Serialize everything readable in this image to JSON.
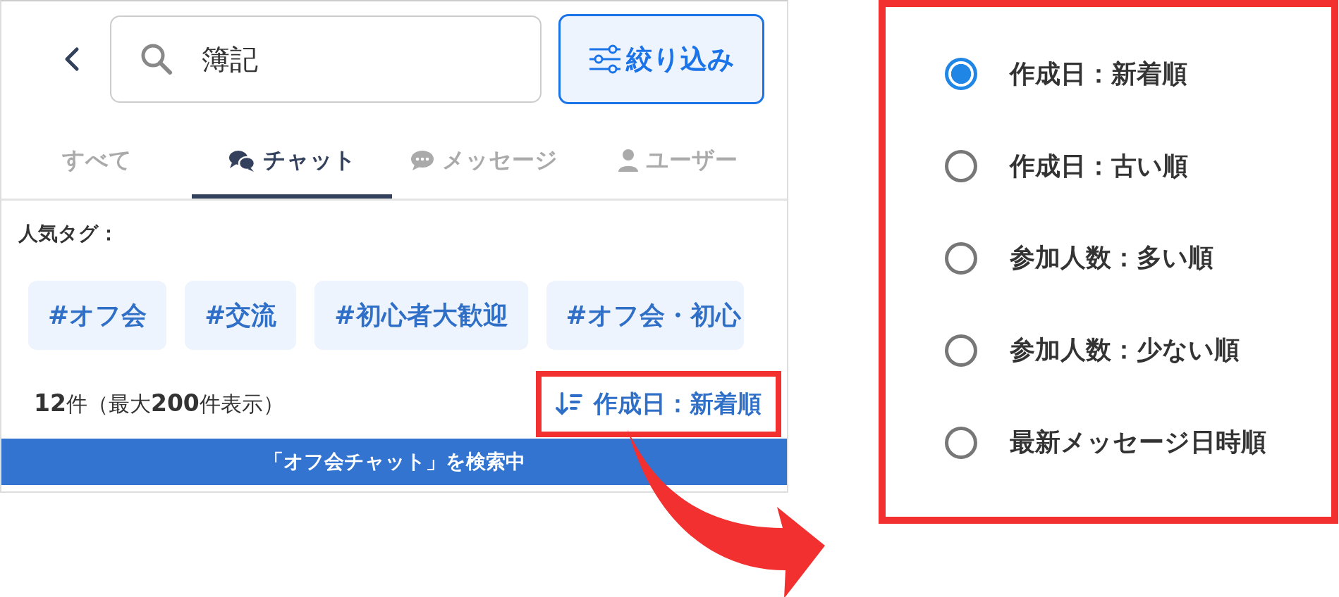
{
  "search": {
    "value": "簿記"
  },
  "filter_button": {
    "label": "絞り込み"
  },
  "tabs": [
    {
      "label": "すべて",
      "kind": "plain",
      "selected": false
    },
    {
      "label": "チャット",
      "kind": "chat",
      "selected": true
    },
    {
      "label": "メッセージ",
      "kind": "message",
      "selected": false
    },
    {
      "label": "ユーザー",
      "kind": "user",
      "selected": false
    }
  ],
  "popular_tags": {
    "label": "人気タグ：",
    "tags": [
      "#オフ会",
      "#交流",
      "#初心者大歓迎",
      "#オフ会・初心"
    ]
  },
  "results": {
    "count": "**12**件（最大**200**件表示）",
    "sort_button": {
      "label": "作成日：新着順"
    }
  },
  "status_banner": "「オフ会チャット」を検索中",
  "sort_menu": {
    "options": [
      {
        "label": "作成日：新着順",
        "selected": true
      },
      {
        "label": "作成日：古い順",
        "selected": false
      },
      {
        "label": "参加人数：多い順",
        "selected": false
      },
      {
        "label": "参加人数：少ない順",
        "selected": false
      },
      {
        "label": "最新メッセージ日時順",
        "selected": false
      }
    ]
  }
}
